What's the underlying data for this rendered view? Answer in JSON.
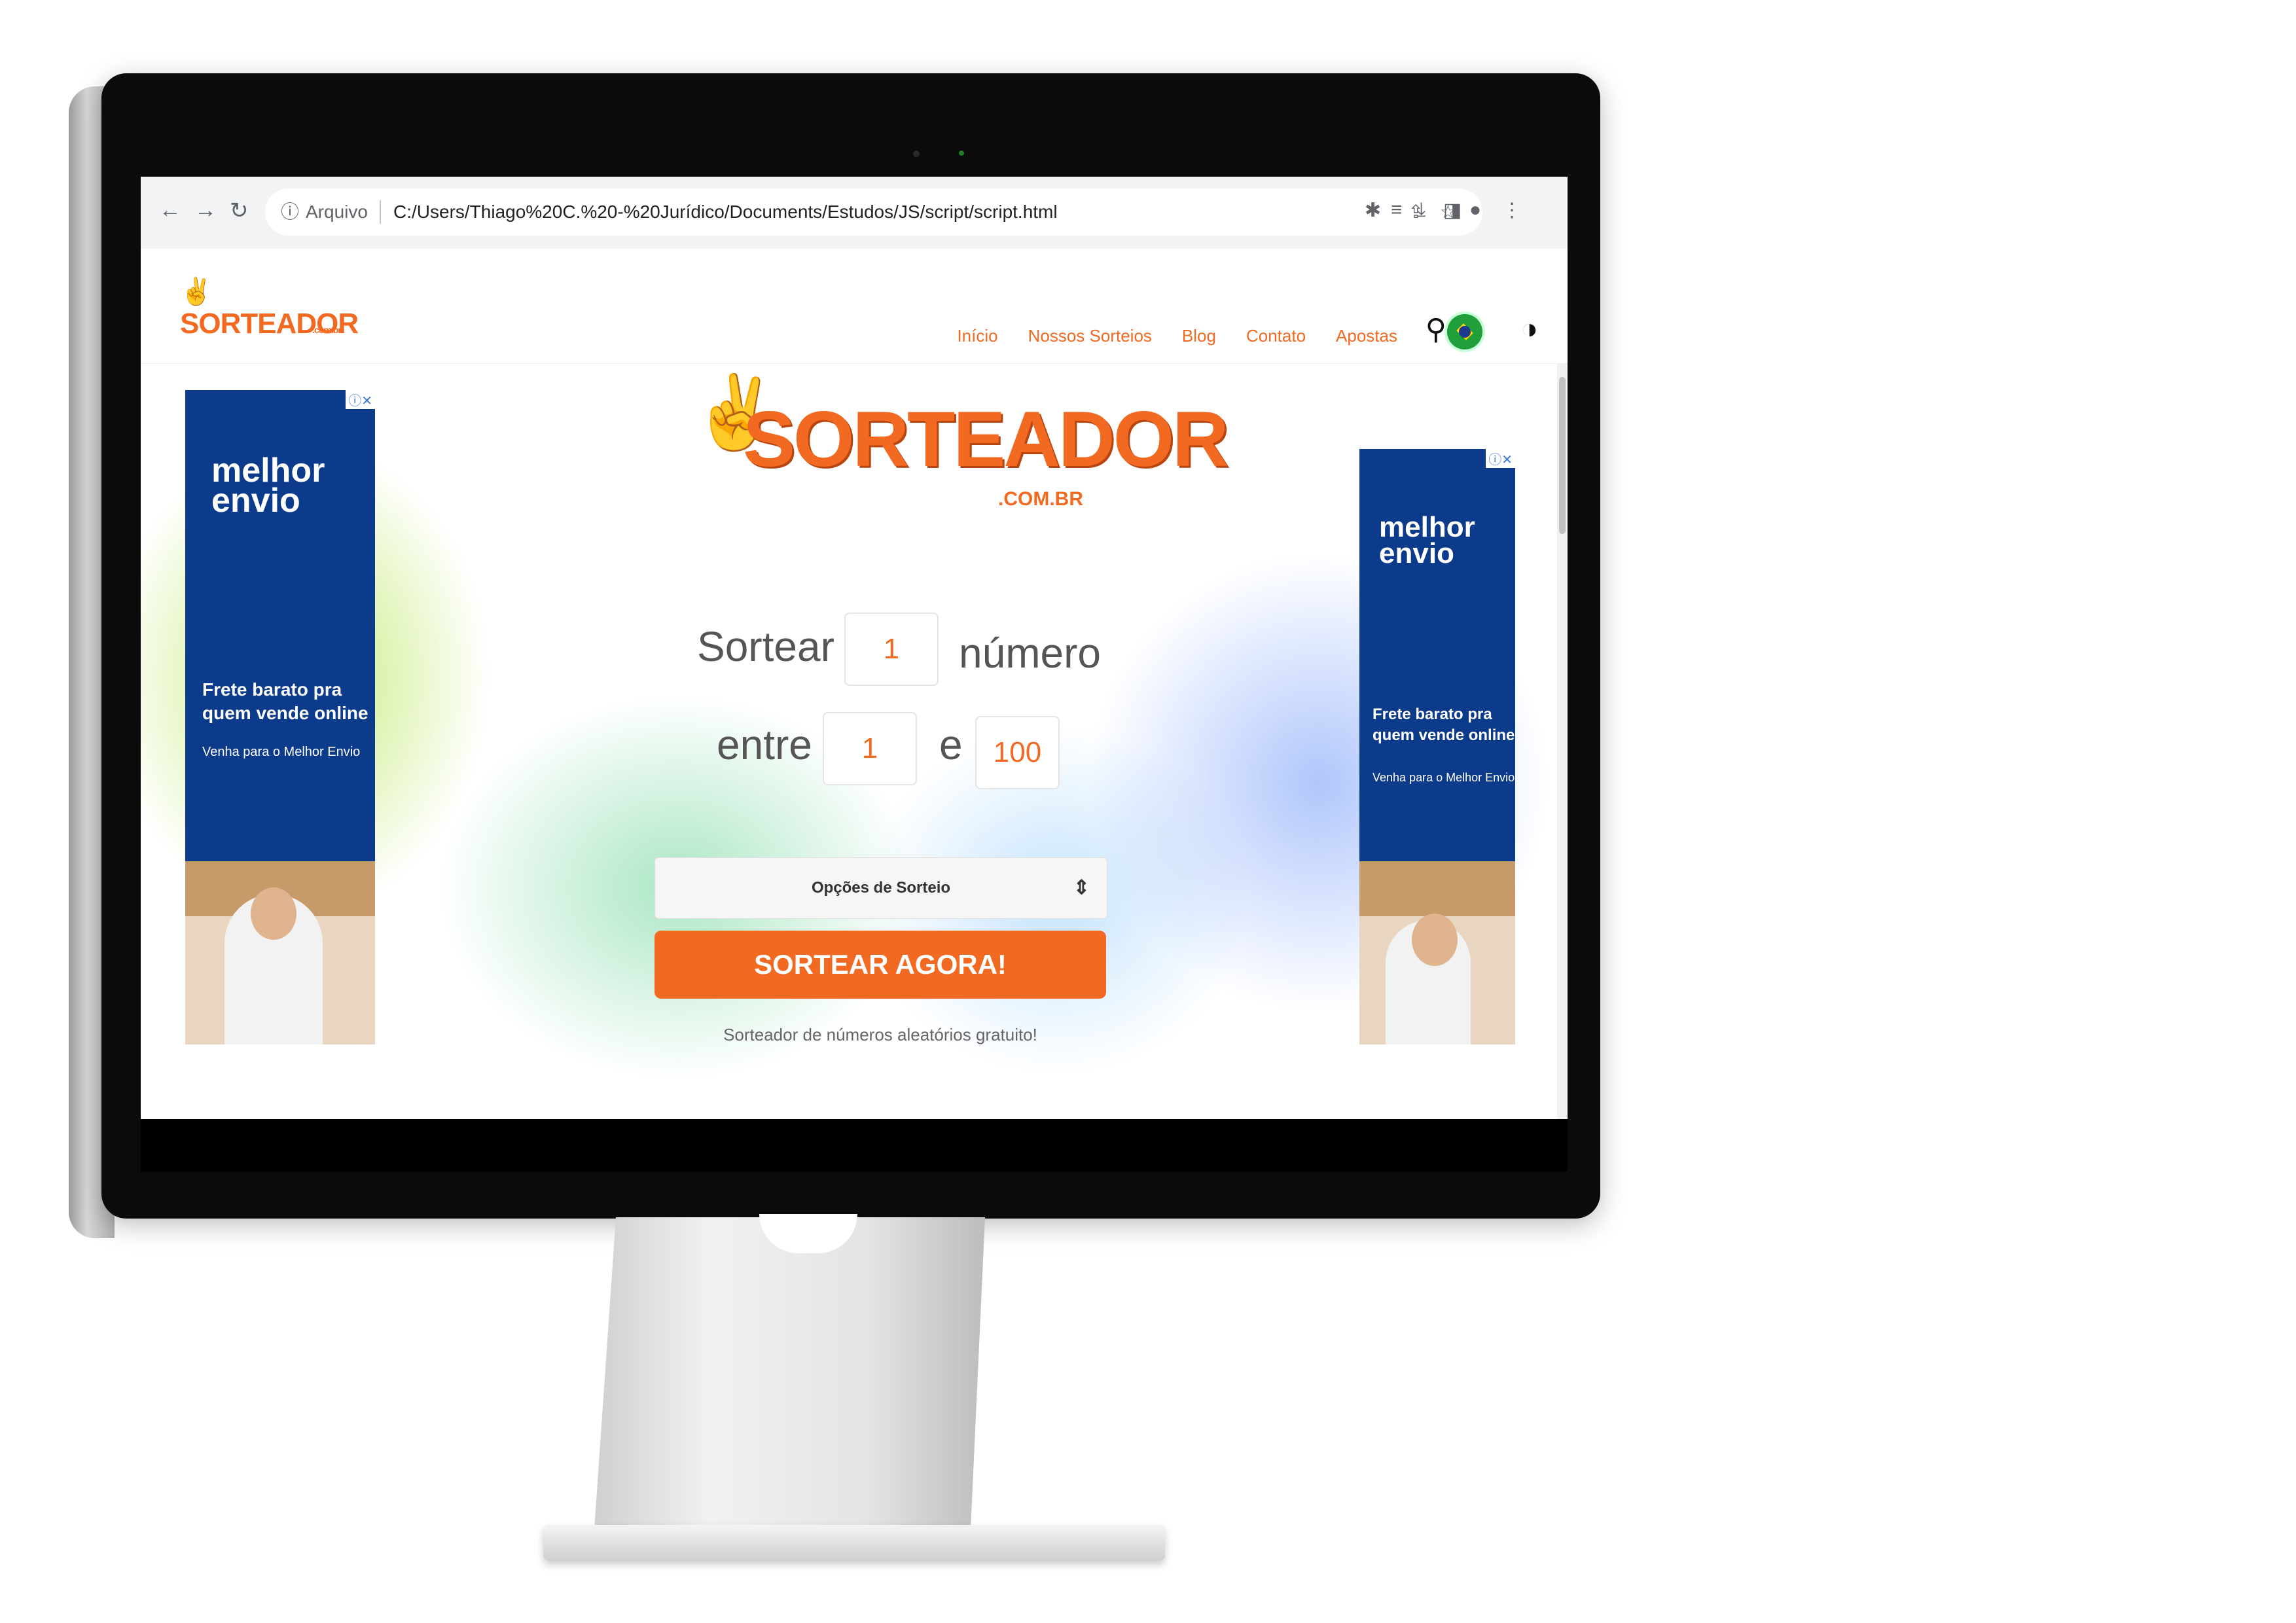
{
  "browser": {
    "address_label": "Arquivo",
    "url": "C:/Users/Thiago%20C.%20-%20Jurídico/Documents/Estudos/JS/script/script.html"
  },
  "site": {
    "logo_small": "SORTEADOR",
    "logo_small_sub": ".com.br",
    "nav": [
      "Início",
      "Nossos Sorteios",
      "Blog",
      "Contato",
      "Apostas"
    ]
  },
  "hero": {
    "logo_word": "SORTEADOR",
    "logo_tld": ".COM.BR"
  },
  "form": {
    "sortear_label": "Sortear",
    "quantity": "1",
    "numero_label": "número",
    "entre_label": "entre",
    "min": "1",
    "e_label": "e",
    "max": "100",
    "options_label": "Opções de Sorteio",
    "cta_label": "SORTEAR AGORA!",
    "tagline": "Sorteador de números aleatórios gratuito!"
  },
  "ads": {
    "brand": "melhor envio",
    "headline": "Frete barato pra quem vende online",
    "sub": "Venha para o Melhor Envio",
    "controls": "ⓘ✕"
  },
  "colors": {
    "accent": "#f26a21",
    "ad_bg": "#0d3b8c"
  },
  "icons": [
    "back-icon",
    "forward-icon",
    "reload-icon",
    "info-icon",
    "share-icon",
    "star-icon",
    "extensions-icon",
    "reading-list-icon",
    "download-icon",
    "sidebar-icon",
    "profile-icon",
    "menu-icon",
    "search-icon",
    "brazil-flag-icon",
    "theme-toggle-icon",
    "select-chevron-icon"
  ]
}
